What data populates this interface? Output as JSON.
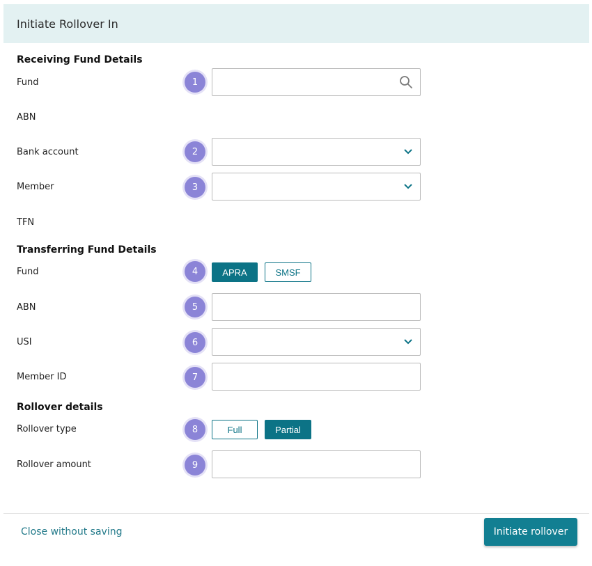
{
  "header": {
    "title": "Initiate Rollover In"
  },
  "receiving": {
    "title": "Receiving Fund Details",
    "fund_label": "Fund",
    "abn_label": "ABN",
    "bank_label": "Bank account",
    "member_label": "Member",
    "tfn_label": "TFN"
  },
  "transferring": {
    "title": "Transferring Fund Details",
    "fund_label": "Fund",
    "fund_options": [
      "APRA",
      "SMSF"
    ],
    "fund_selected": "APRA",
    "abn_label": "ABN",
    "usi_label": "USI",
    "member_id_label": "Member ID"
  },
  "rollover": {
    "title": "Rollover details",
    "type_label": "Rollover type",
    "type_options": [
      "Full",
      "Partial"
    ],
    "type_selected": "Partial",
    "amount_label": "Rollover amount"
  },
  "steps": [
    "1",
    "2",
    "3",
    "4",
    "5",
    "6",
    "7",
    "8",
    "9"
  ],
  "footer": {
    "close_label": "Close without saving",
    "submit_label": "Initiate rollover"
  },
  "colors": {
    "accent": "#0c7386",
    "badge": "#8b84d7",
    "header_bg": "#e3f1f2"
  }
}
